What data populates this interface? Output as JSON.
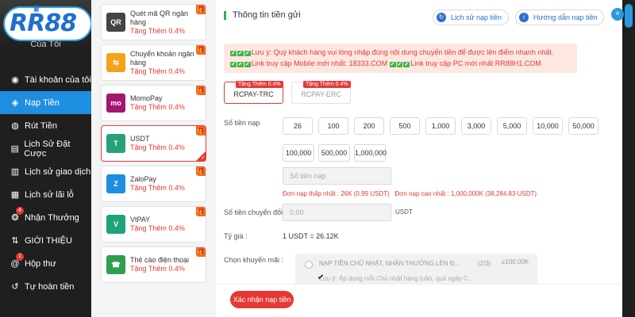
{
  "brand": {
    "logo_text": "RR88"
  },
  "sidebar": {
    "top_label": "Của Tôi",
    "items": [
      {
        "label": "Tài khoản của tôi",
        "icon": "user-icon",
        "active": false
      },
      {
        "label": "Nạp Tiền",
        "icon": "deposit-icon",
        "active": true
      },
      {
        "label": "Rút Tiền",
        "icon": "withdraw-icon",
        "active": false
      },
      {
        "label": "Lịch Sử Đặt Cược",
        "icon": "bet-history-icon",
        "active": false
      },
      {
        "label": "Lịch sử giao dịch",
        "icon": "transaction-icon",
        "active": false
      },
      {
        "label": "Lịch sử lãi lỗ",
        "icon": "profit-loss-icon",
        "active": false
      },
      {
        "label": "Nhận Thưởng",
        "icon": "gift-icon",
        "active": false,
        "badge": "4"
      },
      {
        "label": "GIỚI THIỆU",
        "icon": "referral-icon",
        "active": false
      },
      {
        "label": "Hộp thư",
        "icon": "mail-icon",
        "active": false,
        "badge": "1"
      },
      {
        "label": "Tự hoàn tiền",
        "icon": "cashback-icon",
        "active": false
      }
    ]
  },
  "methods": [
    {
      "name": "Quét mã QR ngân hàng",
      "bonus": "Tặng Thêm 0.4%",
      "logo": "QR",
      "color": "#444444"
    },
    {
      "name": "Chuyển khoản ngân hàng",
      "bonus": "Tặng Thêm 0.4%",
      "logo": "⇆",
      "color": "#f4a21a"
    },
    {
      "name": "MomoPay",
      "bonus": "Tặng Thêm 0.4%",
      "logo": "mo",
      "color": "#a2186f"
    },
    {
      "name": "USDT",
      "bonus": "Tặng Thêm 0.4%",
      "logo": "T",
      "color": "#26a17b",
      "selected": true
    },
    {
      "name": "ZaloPay",
      "bonus": "Tặng Thêm 0.4%",
      "logo": "Z",
      "color": "#1f8de0"
    },
    {
      "name": "VtPAY",
      "bonus": "Tặng Thêm 0.4%",
      "logo": "V",
      "color": "#1fa37a"
    },
    {
      "name": "Thẻ cào điện thoại",
      "bonus": "Tặng Thêm 0.4%",
      "logo": "☎",
      "color": "#2e9e4f"
    }
  ],
  "panel": {
    "title": "Thông tin tiền gửi",
    "history_btn": "Lịch sử nạp tiền",
    "guide_btn": "Hướng dẫn nạp tiền",
    "notice_line1": "Lưu ý: Quý khách hàng vui lòng nhập đúng nội dung chuyển tiền để được lên điểm nhanh nhất.",
    "notice_line2a": "Link truy cập Mobile mới nhất: 18333.COM",
    "notice_line2b": "Link truy cập PC mới nhất RR88H1.COM",
    "channels": [
      {
        "tag": "Tặng Thêm 0.4%",
        "label": "RCPAY-TRC",
        "selected": true
      },
      {
        "tag": "Tặng Thêm 0.4%",
        "label": "RCPAY-ERC",
        "selected": false
      }
    ],
    "amount_label": "Số tiền nạp",
    "amounts_row1": [
      "26",
      "100",
      "200",
      "500",
      "1,000",
      "3,000",
      "5,000",
      "10,000",
      "50,000"
    ],
    "amounts_row2": [
      "100,000",
      "500,000",
      "1,000,000"
    ],
    "amount_placeholder": "Số tiền nạp",
    "min_label": "Đơn nạp thấp nhất :",
    "min_value": "26K (0.99 USDT)",
    "max_label": "Đơn nạp cao nhất :",
    "max_value": "1,000,000K (38,284.83 USDT)",
    "convert_label": "Số tiền chuyển đổi :",
    "convert_value": "0.00",
    "convert_unit": "USDT",
    "rate_label": "Tỷ giá :",
    "rate_value": "1 USDT = 26.12K",
    "promo_label": "Chọn khuyến mãi :",
    "promo_title": "NẠP TIỀN CHỦ NHẬT, NHẬN THƯỞNG LÊN Đ...",
    "promo_count": "(2/3)",
    "promo_max": "≥100.00K",
    "promo_note": "Lưu ý: Áp dụng mỗi Chủ nhật hàng tuần, quà ngày C...",
    "confirm_btn": "Xác nhận nạp tiền"
  }
}
